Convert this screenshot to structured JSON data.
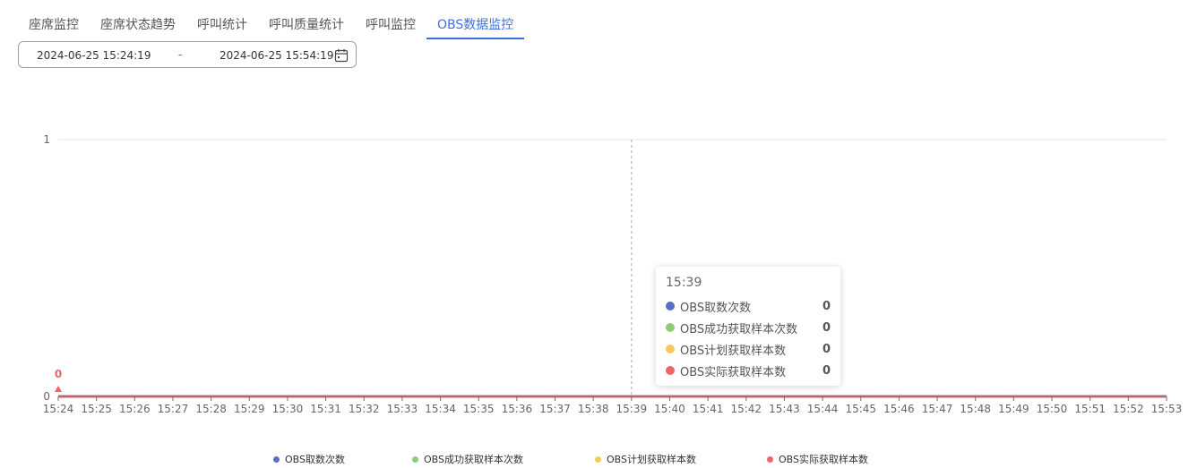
{
  "tabs": [
    {
      "label": "座席监控",
      "active": false
    },
    {
      "label": "座席状态趋势",
      "active": false
    },
    {
      "label": "呼叫统计",
      "active": false
    },
    {
      "label": "呼叫质量统计",
      "active": false
    },
    {
      "label": "呼叫监控",
      "active": false
    },
    {
      "label": "OBS数据监控",
      "active": true
    }
  ],
  "date_range": {
    "start": "2024-06-25 15:24:19",
    "separator": "-",
    "end": "2024-06-25 15:54:19",
    "icon": "calendar-icon"
  },
  "tooltip": {
    "time": "15:39",
    "rows": [
      {
        "name": "OBS取数次数",
        "value": "0",
        "color": "#5470c6"
      },
      {
        "name": "OBS成功获取样本次数",
        "value": "0",
        "color": "#91cc75"
      },
      {
        "name": "OBS计划获取样本数",
        "value": "0",
        "color": "#fac858"
      },
      {
        "name": "OBS实际获取样本数",
        "value": "0",
        "color": "#ee6666"
      }
    ]
  },
  "chart_data": {
    "type": "line",
    "title": "",
    "xlabel": "",
    "ylabel": "",
    "x": [
      "15:24",
      "15:25",
      "15:26",
      "15:27",
      "15:28",
      "15:29",
      "15:30",
      "15:31",
      "15:32",
      "15:33",
      "15:34",
      "15:35",
      "15:36",
      "15:37",
      "15:38",
      "15:39",
      "15:40",
      "15:41",
      "15:42",
      "15:43",
      "15:44",
      "15:45",
      "15:46",
      "15:47",
      "15:48",
      "15:49",
      "15:50",
      "15:51",
      "15:52",
      "15:53"
    ],
    "ylim": [
      0,
      1
    ],
    "yticks": [
      "0",
      "1"
    ],
    "grid": true,
    "legend_position": "bottom",
    "series": [
      {
        "name": "OBS取数次数",
        "color": "#5470c6",
        "values": [
          0,
          0,
          0,
          0,
          0,
          0,
          0,
          0,
          0,
          0,
          0,
          0,
          0,
          0,
          0,
          0,
          0,
          0,
          0,
          0,
          0,
          0,
          0,
          0,
          0,
          0,
          0,
          0,
          0,
          0
        ]
      },
      {
        "name": "OBS成功获取样本次数",
        "color": "#91cc75",
        "values": [
          0,
          0,
          0,
          0,
          0,
          0,
          0,
          0,
          0,
          0,
          0,
          0,
          0,
          0,
          0,
          0,
          0,
          0,
          0,
          0,
          0,
          0,
          0,
          0,
          0,
          0,
          0,
          0,
          0,
          0
        ]
      },
      {
        "name": "OBS计划获取样本数",
        "color": "#fac858",
        "values": [
          0,
          0,
          0,
          0,
          0,
          0,
          0,
          0,
          0,
          0,
          0,
          0,
          0,
          0,
          0,
          0,
          0,
          0,
          0,
          0,
          0,
          0,
          0,
          0,
          0,
          0,
          0,
          0,
          0,
          0
        ]
      },
      {
        "name": "OBS实际获取样本数",
        "color": "#ee6666",
        "values": [
          0,
          0,
          0,
          0,
          0,
          0,
          0,
          0,
          0,
          0,
          0,
          0,
          0,
          0,
          0,
          0,
          0,
          0,
          0,
          0,
          0,
          0,
          0,
          0,
          0,
          0,
          0,
          0,
          0,
          0
        ]
      }
    ],
    "annotation": {
      "label": "0",
      "x": "15:24",
      "y": 0,
      "color": "#ee6666"
    },
    "crosshair_x": "15:39"
  }
}
